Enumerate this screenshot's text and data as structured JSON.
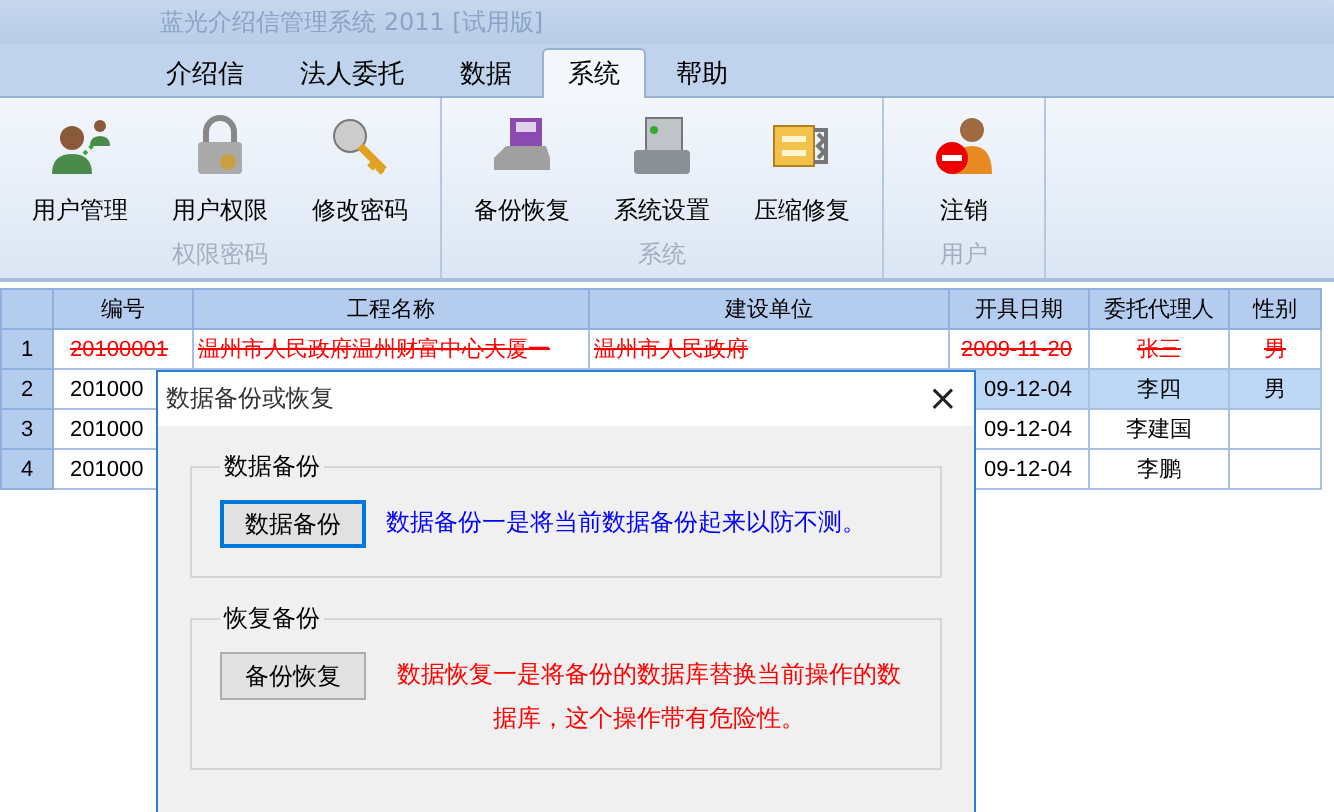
{
  "window": {
    "title": "蓝光介绍信管理系统 2011 [试用版]"
  },
  "tabs": [
    {
      "label": "介绍信",
      "selected": false
    },
    {
      "label": "法人委托",
      "selected": false
    },
    {
      "label": "数据",
      "selected": false
    },
    {
      "label": "系统",
      "selected": true
    },
    {
      "label": "帮助",
      "selected": false
    }
  ],
  "ribbon_groups": [
    {
      "label": "权限密码",
      "buttons": [
        {
          "label": "用户管理"
        },
        {
          "label": "用户权限"
        },
        {
          "label": "修改密码"
        }
      ]
    },
    {
      "label": "系统",
      "buttons": [
        {
          "label": "备份恢复"
        },
        {
          "label": "系统设置"
        },
        {
          "label": "压缩修复"
        }
      ]
    },
    {
      "label": "用户",
      "buttons": [
        {
          "label": "注销"
        }
      ]
    }
  ],
  "table": {
    "columns": [
      "编号",
      "工程名称",
      "建设单位",
      "开具日期",
      "委托代理人",
      "性别"
    ],
    "rows": [
      {
        "index": "1",
        "deleted": true,
        "selected": false,
        "cells": [
          "20100001",
          "温州市人民政府温州财富中心大厦一",
          "温州市人民政府",
          "2009-11-20",
          "张三",
          "男"
        ]
      },
      {
        "index": "2",
        "deleted": false,
        "selected": true,
        "cells": [
          "201000",
          null,
          null,
          "09-12-04",
          "李四",
          "男"
        ]
      },
      {
        "index": "3",
        "deleted": false,
        "selected": false,
        "cells": [
          "201000",
          null,
          null,
          "09-12-04",
          "李建国",
          null
        ]
      },
      {
        "index": "4",
        "deleted": false,
        "selected": false,
        "cells": [
          "201000",
          null,
          null,
          "09-12-04",
          "李鹏",
          null
        ]
      }
    ]
  },
  "dialog": {
    "title": "数据备份或恢复",
    "close": "×",
    "groups": [
      {
        "label": "数据备份",
        "button": "数据备份",
        "focused": true,
        "description": "数据备份一是将当前数据备份起来以防不测。",
        "color": "#0000ff"
      },
      {
        "label": "恢复备份",
        "button": "备份恢复",
        "focused": false,
        "description": "数据恢复一是将备份的数据库替换当前操作的数据库，这个操作带有危险性。",
        "color": "#ff0000"
      }
    ]
  }
}
